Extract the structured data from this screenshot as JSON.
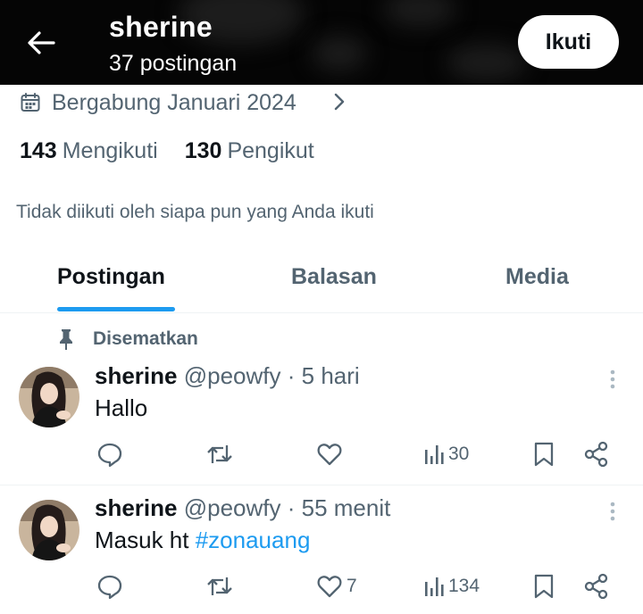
{
  "header": {
    "name": "sherine",
    "post_count": "37 postingan",
    "follow_label": "Ikuti"
  },
  "profile": {
    "joined": "Bergabung Januari 2024",
    "following_count": "143",
    "following_label": "Mengikuti",
    "followers_count": "130",
    "followers_label": "Pengikut",
    "mutual_note": "Tidak diikuti oleh siapa pun yang Anda ikuti"
  },
  "tabs": [
    {
      "label": "Postingan",
      "active": true
    },
    {
      "label": "Balasan",
      "active": false
    },
    {
      "label": "Media",
      "active": false
    }
  ],
  "pinned_label": "Disematkan",
  "posts": [
    {
      "name": "sherine",
      "handle": "@peowfy",
      "time": "· 5 hari",
      "text": "Hallo",
      "hashtag": "",
      "likes": "",
      "views": "30"
    },
    {
      "name": "sherine",
      "handle": "@peowfy",
      "time": "· 55 menit",
      "text": "Masuk ht ",
      "hashtag": "#zonauang",
      "likes": "7",
      "views": "134"
    }
  ],
  "colors": {
    "accent": "#1d9bf0",
    "text_primary": "#0f1419",
    "text_secondary": "#536471",
    "header_bg": "#050505"
  },
  "icons": [
    "back-arrow-icon",
    "calendar-icon",
    "chevron-right-icon",
    "pin-icon",
    "more-vertical-icon",
    "reply-icon",
    "repost-icon",
    "like-icon",
    "views-icon",
    "bookmark-icon",
    "share-icon"
  ]
}
